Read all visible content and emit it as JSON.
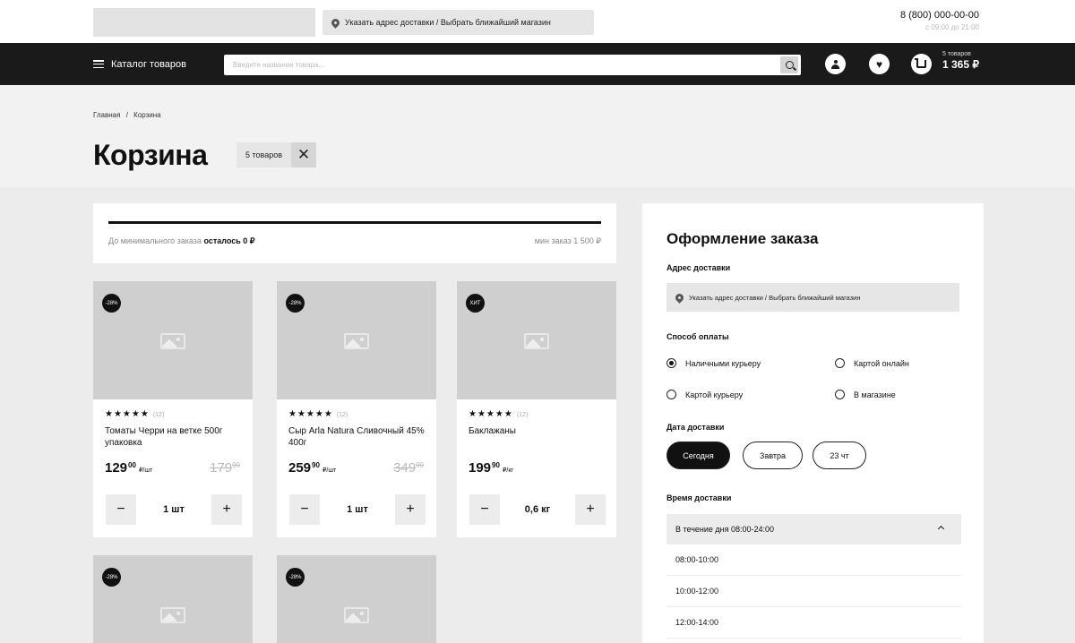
{
  "header": {
    "delivery_address_button": "Указать адрес доставки / Выбрать ближайший магазин",
    "phone": "8 (800) 000-00-00",
    "hours": "с 09:00 до 21:00"
  },
  "navbar": {
    "catalog_label": "Каталог товаров",
    "search_placeholder": "Введите название товара...",
    "cart_count": "5 товаров",
    "cart_total": "1 365 ₽"
  },
  "breadcrumb": {
    "home": "Главная",
    "separator": "/",
    "current": "Корзина"
  },
  "page": {
    "title": "Корзина",
    "item_count_tag": "5 товаров",
    "clear_symbol": "✕"
  },
  "min_order": {
    "label": "До минимального заказа",
    "remaining": "осталось 0 ₽",
    "min_sum": "мин заказ 1 500 ₽",
    "progress_fraction": 1.0
  },
  "products": [
    {
      "badge": "-28%",
      "stars": "★★★★★",
      "reviews": "(12)",
      "name": "Томаты Черри на ветке 500г упаковка",
      "price_int": "129",
      "price_frac": "00",
      "unit": "₽/шт",
      "old_int": "179",
      "old_frac": "90",
      "qty": "1 шт"
    },
    {
      "badge": "-28%",
      "stars": "★★★★★",
      "reviews": "(12)",
      "name": "Сыр Arla Natura Сливочный 45% 400г",
      "price_int": "259",
      "price_frac": "90",
      "unit": "₽/шт",
      "old_int": "349",
      "old_frac": "90",
      "qty": "1 шт"
    },
    {
      "badge": "ХИТ",
      "stars": "★★★★★",
      "reviews": "(12)",
      "name": "Баклажаны",
      "price_int": "199",
      "price_frac": "90",
      "unit": "₽/кг",
      "old_int": "",
      "old_frac": "",
      "qty": "0,6 кг"
    },
    {
      "badge": "-28%"
    },
    {
      "badge": "-28%"
    }
  ],
  "qty_controls": {
    "minus": "−",
    "plus": "+"
  },
  "checkout": {
    "title": "Оформление заказа",
    "address_label": "Адрес доставки",
    "address_button": "Указать адрес доставки / Выбрать ближайший магазин",
    "payment_label": "Способ оплаты",
    "payment_options": [
      "Наличными курьеру",
      "Картой онлайн",
      "Картой курьеру",
      "В магазине"
    ],
    "payment_selected": "Наличными курьеру",
    "date_label": "Дата доставки",
    "date_options": [
      "Сегодня",
      "Завтра",
      "23 чт"
    ],
    "date_selected": "Сегодня",
    "time_label": "Время доставки",
    "time_selected": "В течение дня 08:00-24:00",
    "time_options": [
      "08:00-10:00",
      "10:00-12:00",
      "12:00-14:00"
    ]
  }
}
